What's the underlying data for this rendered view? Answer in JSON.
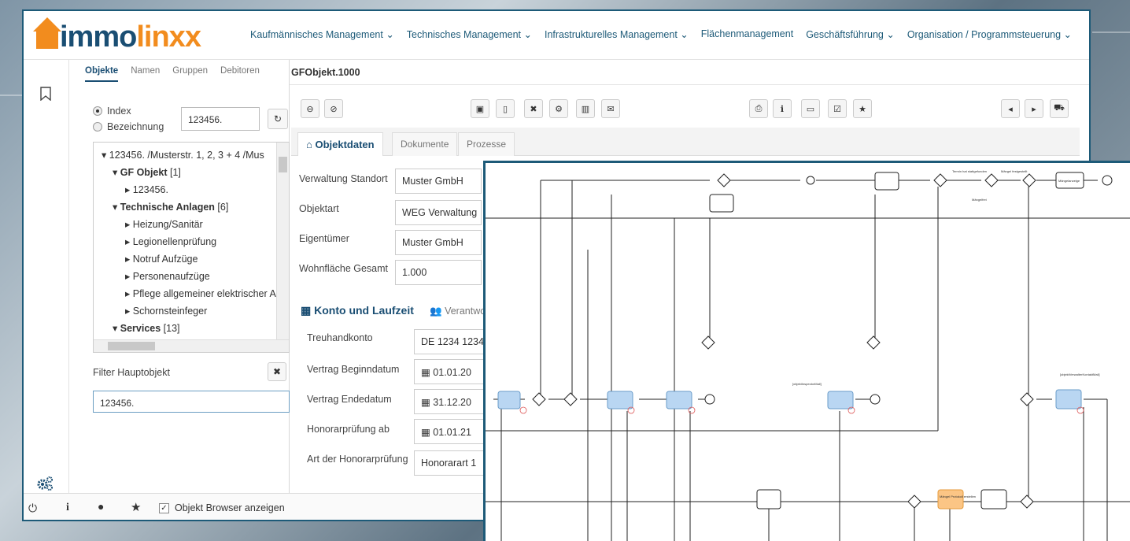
{
  "logo": {
    "text_a": "immo",
    "text_b": "linxx"
  },
  "nav": [
    "Kaufmännisches Management ⌄",
    "Technisches Management ⌄",
    "Infrastrukturelles Management ⌄",
    "Flächenmanagement",
    "Geschäftsführung ⌄",
    "Organisation / Programmsteuerung ⌄"
  ],
  "sidebar": {
    "tabs": [
      "Objekte",
      "Namen",
      "Gruppen",
      "Debitoren"
    ],
    "radio_index": "Index",
    "radio_bezeichnung": "Bezeichnung",
    "search_value": "123456.",
    "tree": {
      "root": "123456.  /Musterstr. 1, 2, 3 + 4 /Mus",
      "gf": "GF Objekt",
      "gf_count": "[1]",
      "gf_child": "123456.",
      "ta": "Technische Anlagen",
      "ta_count": "[6]",
      "ta_children": [
        "Heizung/Sanitär",
        "Legionellenprüfung",
        "Notruf Aufzüge",
        "Personenaufzüge",
        "Pflege allgemeiner elektrischer A",
        "Schornsteinfeger"
      ],
      "services": "Services",
      "services_count": "[13]"
    },
    "filter_label": "Filter Hauptobjekt",
    "filter_value": "123456."
  },
  "statusbar": {
    "checkbox_label": "Objekt Browser anzeigen"
  },
  "content": {
    "title": "GFObjekt.1000",
    "tabs": [
      "Objektdaten",
      "Dokumente",
      "Prozesse"
    ],
    "fields": [
      {
        "label": "Verwaltung Standort",
        "value": "Muster GmbH"
      },
      {
        "label": "Objektart",
        "value": "WEG Verwaltung"
      },
      {
        "label": "Eigentümer",
        "value": "Muster GmbH"
      },
      {
        "label": "Wohnfläche Gesamt",
        "value": "1.000"
      }
    ],
    "section_title": "Konto und Laufzeit",
    "section_tab2": "Verantwo",
    "fields2": [
      {
        "label": "Treuhandkonto",
        "value": "DE 1234 1234"
      },
      {
        "label": "Vertrag Beginndatum",
        "value": "01.01.20"
      },
      {
        "label": "Vertrag Endedatum",
        "value": "31.12.20"
      },
      {
        "label": "Honorarprüfung ab",
        "value": "01.01.21"
      },
      {
        "label": "Art der Honorarprüfung",
        "value": "Honorarart 1"
      }
    ]
  },
  "diagram": {
    "top_labels": [
      "Mängelanzeige",
      "Mängel festgestellt",
      "Termin hat stattgefunden",
      "Mängelfrei"
    ],
    "mid_labels": [
      "[objektInspectorMail]",
      "[objektVerwalterKontaktMail]"
    ],
    "orange_task": "Mängel Protokoll erstellen",
    "accent_blue": "#b9d6f2",
    "accent_orange": "#fbc585"
  }
}
